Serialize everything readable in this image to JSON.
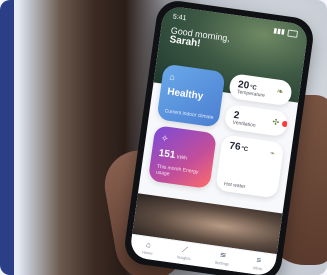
{
  "app": {
    "status": {
      "time": "5:41"
    },
    "greeting": {
      "line1": "Good morning,",
      "name": "Sarah!"
    },
    "tiles": {
      "healthy": {
        "title": "Healthy",
        "subtitle": "Current indoor climate",
        "icon": "home-icon"
      },
      "energy": {
        "value": "151",
        "unit": "kWh",
        "subtitle": "This month Energy usage",
        "icon": "sparkle-icon"
      },
      "temperature": {
        "value": "20",
        "unit": "°C",
        "label": "Temperature",
        "icon": "leaf-icon"
      },
      "ventilation": {
        "value": "2",
        "label": "Ventilation",
        "icon": "fan-icon"
      },
      "hot_water": {
        "value": "76",
        "unit": "°C",
        "label": "Hot water",
        "icon": "drop-icon"
      }
    },
    "nav": [
      {
        "label": "Home",
        "icon": "home-icon"
      },
      {
        "label": "Insights",
        "icon": "trend-icon"
      },
      {
        "label": "Settings",
        "icon": "sliders-icon"
      },
      {
        "label": "More",
        "icon": "menu-icon"
      }
    ]
  }
}
